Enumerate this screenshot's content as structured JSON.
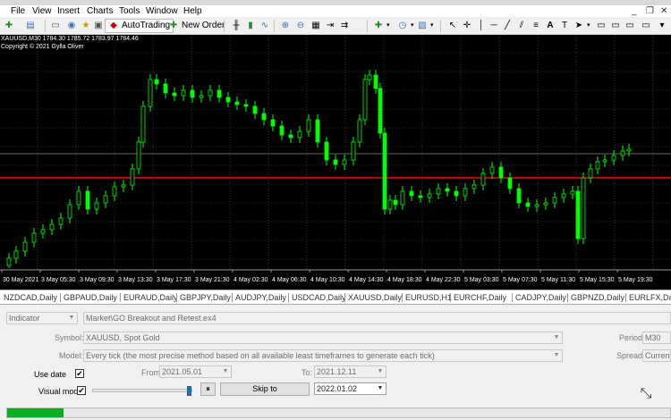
{
  "menu": [
    "File",
    "View",
    "Insert",
    "Charts",
    "Tools",
    "Window",
    "Help"
  ],
  "toolbar": {
    "autotrading": "AutoTrading",
    "new_order": "New Order"
  },
  "chart": {
    "info": "XAUUSD,M30  1784.30 1785.72 1783.97 1784.46",
    "copyright": "Copyright © 2021 Gylla Oliver",
    "background": "#000000",
    "bull_color": "#00ff00",
    "line_color": "#ff0000",
    "time_labels": [
      "30 May 2021",
      "3 May 05:30",
      "3 May 09:30",
      "3 May 13:30",
      "3 May 17:30",
      "3 May 21:30",
      "4 May 02:30",
      "4 May 06:30",
      "4 May 10:30",
      "4 May 14:30",
      "4 May 18:30",
      "4 May 22:30",
      "5 May 03:30",
      "5 May 07:30",
      "5 May 11:30",
      "5 May 15:30",
      "5 May 19:30"
    ]
  },
  "tabs": [
    "NZDCAD,Daily",
    "GBPAUD,Daily",
    "EURAUD,Daily",
    "GBPJPY,Daily",
    "AUDJPY,Daily",
    "USDCAD,Daily",
    "XAUUSD,Daily",
    "EURUSD,H1",
    "EURCHF,Daily",
    "CADJPY,Daily",
    "GBPNZD,Daily",
    "EURLFX,Daily"
  ],
  "tester": {
    "type": "Indicator",
    "expert": "Market\\GO Breakout and Retest.ex4",
    "symbol_label": "Symbol:",
    "symbol": "XAUUSD, Spot Gold",
    "model_label": "Model:",
    "model": "Every tick (the most precise method based on all available least timeframes to generate each tick)",
    "period_label": "Period:",
    "period": "M30",
    "spread_label": "Spread:",
    "spread": "Current",
    "use_date_label": "Use date",
    "use_date_checked": "✔",
    "from_label": "From:",
    "from": "2021.05.01",
    "to_label": "To:",
    "to": "2021.12.11",
    "visual_label": "Visual mode",
    "visual_checked": "✔",
    "pause": "⏸",
    "skip_to": "Skip to",
    "skip_date": "2022.01.02",
    "progress_fraction": 0.085
  }
}
